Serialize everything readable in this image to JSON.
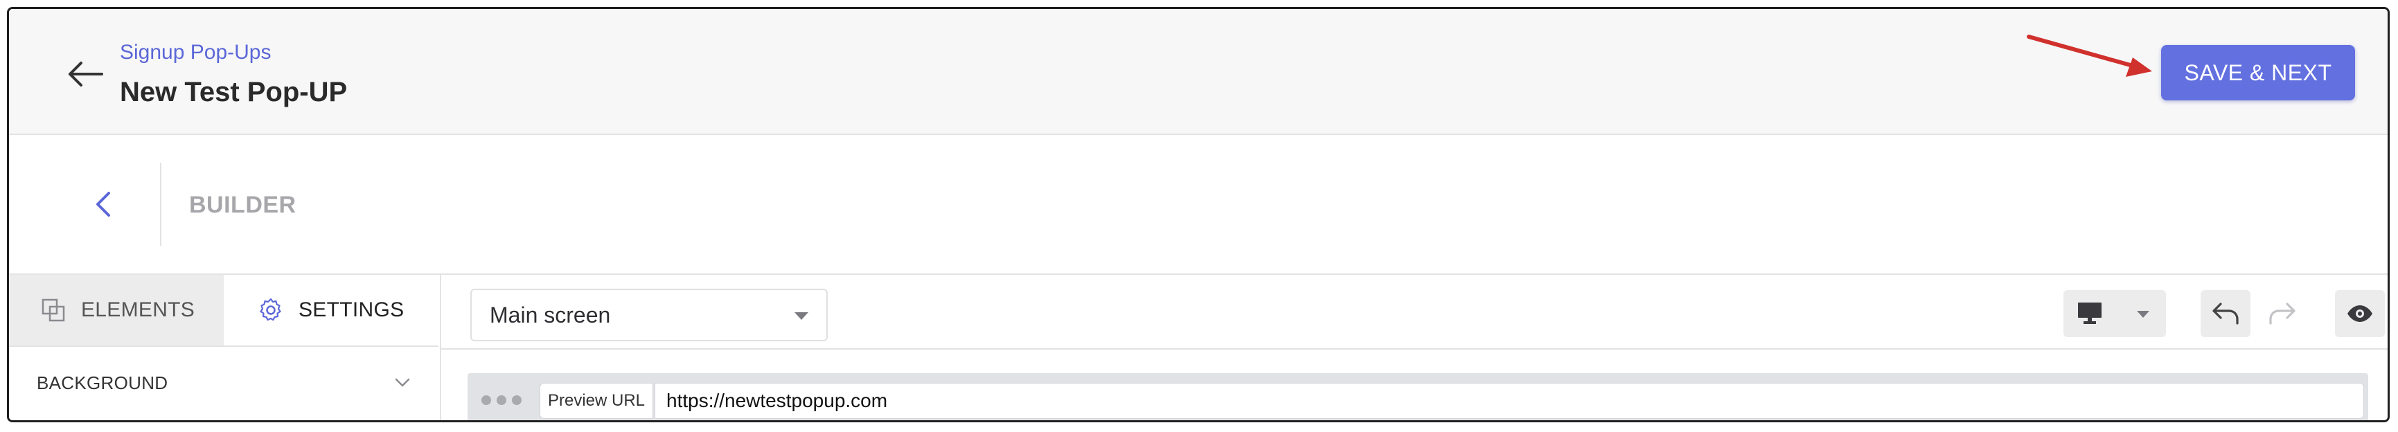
{
  "header": {
    "breadcrumb": "Signup Pop-Ups",
    "title": "New Test Pop-UP",
    "save_label": "SAVE & NEXT",
    "accent_color": "#6370e0",
    "annotation_arrow_color": "#d0312d"
  },
  "builder": {
    "label": "BUILDER"
  },
  "left_panel": {
    "tabs": [
      {
        "label": "ELEMENTS",
        "icon": "layers-icon",
        "active": false
      },
      {
        "label": "SETTINGS",
        "icon": "gear-icon",
        "active": true
      }
    ],
    "sections": [
      {
        "label": "BACKGROUND",
        "icon": "chevron-down-icon",
        "expanded": false
      }
    ]
  },
  "toolbar": {
    "screen_select": {
      "value": "Main screen"
    },
    "device": {
      "icon": "desktop-icon",
      "dropdown_icon": "caret-down-icon"
    },
    "undo_icon": "undo-icon",
    "redo_icon": "redo-icon",
    "preview_icon": "eye-icon"
  },
  "preview": {
    "url_label": "Preview URL",
    "url_value": "https://newtestpopup.com"
  }
}
